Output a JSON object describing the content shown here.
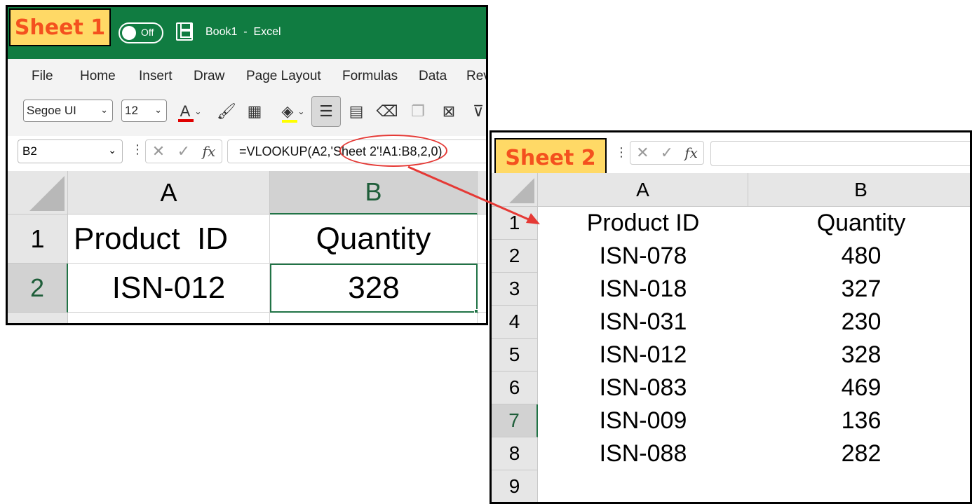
{
  "sheet1": {
    "tag": "Sheet 1",
    "autosave_label": "Off",
    "doc_title": "Book1  -  Excel",
    "tabs": [
      "File",
      "Home",
      "Insert",
      "Draw",
      "Page Layout",
      "Formulas",
      "Data",
      "Rev"
    ],
    "font_name": "Segoe UI",
    "font_size": "12",
    "name_box": "B2",
    "fx_label": "fx",
    "formula": "=VLOOKUP(A2,'Sheet 2'!A1:B8,2,0)",
    "col_headers": [
      "A",
      "B"
    ],
    "rows": [
      {
        "num": "1",
        "a": "Product  ID",
        "b": "Quantity"
      },
      {
        "num": "2",
        "a": "ISN-012",
        "b": "328"
      }
    ]
  },
  "sheet2": {
    "tag": "Sheet 2",
    "fx_label": "fx",
    "col_headers": [
      "A",
      "B"
    ],
    "rows": [
      {
        "num": "1",
        "a": "Product ID",
        "b": "Quantity"
      },
      {
        "num": "2",
        "a": "ISN-078",
        "b": "480"
      },
      {
        "num": "3",
        "a": "ISN-018",
        "b": "327"
      },
      {
        "num": "4",
        "a": "ISN-031",
        "b": "230"
      },
      {
        "num": "5",
        "a": "ISN-012",
        "b": "328"
      },
      {
        "num": "6",
        "a": "ISN-083",
        "b": "469"
      },
      {
        "num": "7",
        "a": "ISN-009",
        "b": "136"
      },
      {
        "num": "8",
        "a": "ISN-088",
        "b": "282"
      },
      {
        "num": "9",
        "a": "",
        "b": ""
      }
    ]
  },
  "colors": {
    "titlebar": "#107c41",
    "tag_bg": "#ffd966",
    "tag_text": "#f4511e",
    "annotation": "#e53935",
    "selection": "#217346"
  }
}
